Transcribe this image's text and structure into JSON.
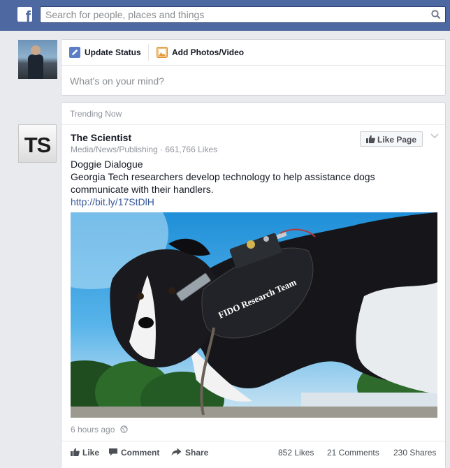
{
  "header": {
    "logo_letter": "f",
    "search": {
      "placeholder": "Search for people, places and things",
      "icon": "search-icon"
    }
  },
  "composer": {
    "tabs": [
      {
        "label": "Update Status",
        "icon": "pencil-icon"
      },
      {
        "label": "Add Photos/Video",
        "icon": "photo-icon"
      }
    ],
    "placeholder": "What's on your mind?"
  },
  "feed": {
    "post": {
      "section_label": "Trending Now",
      "page_initials": "TS",
      "page_name": "The Scientist",
      "page_meta": "Media/News/Publishing · 661,766 Likes",
      "like_page_label": "Like Page",
      "text_title": "Doggie Dialogue",
      "text_body": "Georgia Tech researchers develop technology to help assistance dogs communicate with their handlers.",
      "link": "http://bit.ly/17StDlH",
      "image_vest_text": "FIDO Research Team",
      "timestamp": "6 hours ago",
      "privacy_icon": "globe-icon",
      "actions": {
        "like": "Like",
        "comment": "Comment",
        "share": "Share"
      },
      "stats": {
        "likes": "852 Likes",
        "comments": "21 Comments",
        "shares": "230 Shares"
      }
    }
  },
  "colors": {
    "topbar": "#4e69a2",
    "link": "#365899",
    "background": "#e9eaed"
  }
}
